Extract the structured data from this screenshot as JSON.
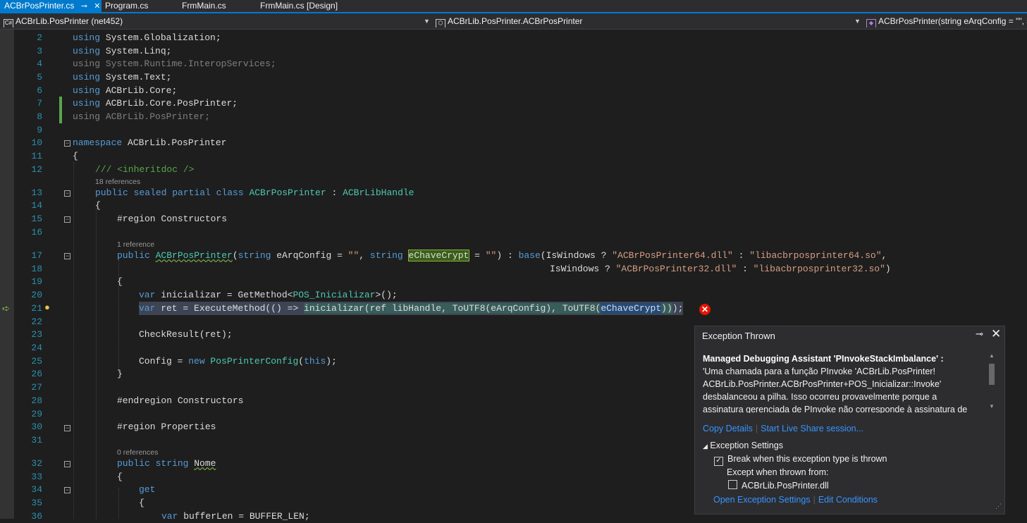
{
  "tabs": [
    {
      "label": "ACBrPosPrinter.cs",
      "pin": "⊸",
      "close": "✕"
    },
    {
      "label": "Program.cs"
    },
    {
      "label": "FrmMain.cs"
    },
    {
      "label": "FrmMain.cs [Design]"
    }
  ],
  "nav": {
    "project": "ACBrLib.PosPrinter (net452)",
    "class": "ACBrLib.PosPrinter.ACBrPosPrinter",
    "member": "ACBrPosPrinter(string eArqConfig = \"\", s"
  },
  "editor": {
    "line_numbers": [
      "2",
      "3",
      "4",
      "5",
      "6",
      "7",
      "8",
      "9",
      "10",
      "11",
      "12",
      "13",
      "14",
      "15",
      "16",
      "17",
      "18",
      "19",
      "20",
      "21",
      "22",
      "23",
      "24",
      "25",
      "26",
      "27",
      "28",
      "29",
      "30",
      "31",
      "32",
      "33",
      "34",
      "35",
      "36"
    ],
    "codelens": {
      "refs18": "18 references",
      "refs1": "1 reference",
      "refs0": "0 references"
    },
    "code": {
      "l2": "System.Globalization;",
      "l3": "System.Linq;",
      "l4": "System.Runtime.InteropServices;",
      "l5": "System.Text;",
      "l6": "ACBrLib.Core;",
      "l7": "ACBrLib.Core.PosPrinter;",
      "l8": "ACBrLib.PosPrinter;",
      "using": "using",
      "namespace_kw": "namespace",
      "namespace_name": " ACBrLib.PosPrinter",
      "brace_open": "{",
      "brace_close": "}",
      "doc": "/// <inheritdoc />",
      "class_mods": "public sealed partial class ",
      "class_name": "ACBrPosPrinter",
      "class_colon": " : ",
      "class_base": "ACBrLibHandle",
      "region_ctor": "#region",
      "region_ctor_name": " Constructors",
      "ctor_public": "public ",
      "ctor_name": "ACBrPosPrinter",
      "ctor_p1": "(",
      "ctor_string": "string",
      "ctor_p2": " eArqConfig = ",
      "ctor_empty": "\"\"",
      "ctor_p3": ", ",
      "ctor_string2": "string",
      "ctor_p4": " ",
      "ctor_ekey": "eChaveCrypt",
      "ctor_p5": " = ",
      "ctor_empty2": "\"\"",
      "ctor_p6": ") : ",
      "ctor_base": "base",
      "ctor_p7": "(IsWindows ? ",
      "ctor_dll64": "\"ACBrPosPrinter64.dll\"",
      "ctor_p8": " : ",
      "ctor_so64": "\"libacbrposprinter64.so\"",
      "ctor_p9": ",",
      "l18_pre": "IsWindows ? ",
      "l18_dll": "\"ACBrPosPrinter32.dll\"",
      "l18_mid": " : ",
      "l18_so": "\"libacbrposprinter32.so\"",
      "l18_end": ")",
      "l20_var": "var",
      "l20_a": " inicializar = GetMethod<",
      "l20_t": "POS_Inicializar",
      "l20_b": ">();",
      "l21_var": "var",
      "l21_a": " ret = ExecuteMethod(() => ",
      "l21_b": "inicializar(ref libHandle, ToUTF8(eArqConfig), ToUTF8(",
      "l21_c": "eChaveCrypt",
      "l21_d": "))",
      "l21_e": ");",
      "l23": "CheckResult(ret);",
      "l25_a": "Config = ",
      "l25_new": "new",
      "l25_t": " PosPrinterConfig",
      "l25_b": "(",
      "l25_this": "this",
      "l25_c": ");",
      "endregion": "#endregion",
      "endregion_name": " Constructors",
      "region_props": "#region",
      "region_props_name": " Properties",
      "l32_kw": "public string ",
      "l32_name": "Nome",
      "l34_get": "get",
      "l36_var": "var",
      "l36_rest": " bufferLen = BUFFER_LEN;"
    }
  },
  "exception_popup": {
    "title": "Exception Thrown",
    "pin": "⊸",
    "close": "✕",
    "heading": "Managed Debugging Assistant 'PInvokeStackImbalance' :",
    "message": "'Uma chamada para a função PInvoke 'ACBrLib.PosPrinter! ACBrLib.PosPrinter.ACBrPosPrinter+POS_Inicializar::Invoke' desbalanceou a pilha. Isso ocorreu provavelmente porque a assinatura gerenciada de PInvoke não corresponde à assinatura de",
    "copy_details": "Copy Details",
    "live_share": "Start Live Share session...",
    "settings_header": "Exception Settings",
    "break_when": "Break when this exception type is thrown",
    "except_when": "Except when thrown from:",
    "module": "ACBrLib.PosPrinter.dll",
    "open_settings": "Open Exception Settings",
    "edit_conditions": "Edit Conditions",
    "break_checked": true,
    "module_checked": false
  },
  "colors": {
    "accent": "#007acc",
    "error": "#e51400"
  }
}
